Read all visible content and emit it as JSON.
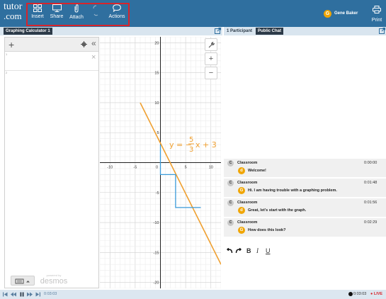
{
  "brand": {
    "line1": "tutor",
    "line2": ".com",
    "line3": ""
  },
  "toolbar": {
    "insert_label": "Insert",
    "share_label": "Share",
    "attach_label": "Attach",
    "actions_label": "Actions",
    "print_label": "Print",
    "highlight_color": "#d8242b"
  },
  "user": {
    "initial": "G",
    "name": "Gene Baker"
  },
  "calculator": {
    "tab_title": "Graphing Calculator 1",
    "add_symbol": "+",
    "collapse_symbol": "«",
    "clear_symbol": "×",
    "expr_index_1": "1",
    "expr_index_2": "2",
    "powered_by": "powered by",
    "powered_name": "desmos"
  },
  "graph": {
    "xlim": [
      -12,
      12
    ],
    "ylim": [
      -21,
      21
    ],
    "x_ticks": [
      "-10",
      "-5",
      "0",
      "5",
      "10"
    ],
    "y_ticks": [
      "20",
      "15",
      "10",
      "5",
      "-5",
      "-10",
      "-15",
      "-20"
    ],
    "handwriting_parts": [
      "y = −",
      "5",
      "3",
      "x + 3"
    ],
    "line_color": "#f0a030",
    "annotation_color": "#3a9ad9",
    "tools": [
      "wrench",
      "+",
      "−"
    ]
  },
  "chart_data": {
    "type": "line",
    "title": "",
    "xlabel": "",
    "ylabel": "",
    "xlim": [
      -12,
      12
    ],
    "ylim": [
      -21,
      21
    ],
    "grid": true,
    "series": [
      {
        "name": "",
        "x": [
          -4,
          12
        ],
        "y": [
          10,
          -17
        ]
      }
    ],
    "annotations": [
      {
        "type": "step",
        "points": [
          [
            0,
            3
          ],
          [
            0,
            -2
          ],
          [
            3,
            -2
          ],
          [
            3,
            -7.5
          ],
          [
            8,
            -7.5
          ]
        ]
      }
    ]
  },
  "chat": {
    "participants_label": "1 Participant",
    "tab_label": "Public Chat",
    "messages": [
      {
        "sender": "Classroom",
        "time": "0:00:00",
        "initial": "d",
        "text": "Welcome!"
      },
      {
        "sender": "Classroom",
        "time": "0:01:48",
        "initial": "G",
        "text": "Hi. I am having trouble with a graphing problem."
      },
      {
        "sender": "Classroom",
        "time": "0:01:56",
        "initial": "d",
        "text": "Great, let's start with the graph."
      },
      {
        "sender": "Classroom",
        "time": "0:02:29",
        "initial": "G",
        "text": "How does this look?"
      }
    ],
    "sender_initial": "C",
    "format_bold": "B",
    "format_italic": "I",
    "format_underline": "U"
  },
  "playback": {
    "current_time": "0:03:03",
    "right_time": "0:03:03",
    "live_label": "● LIVE"
  }
}
